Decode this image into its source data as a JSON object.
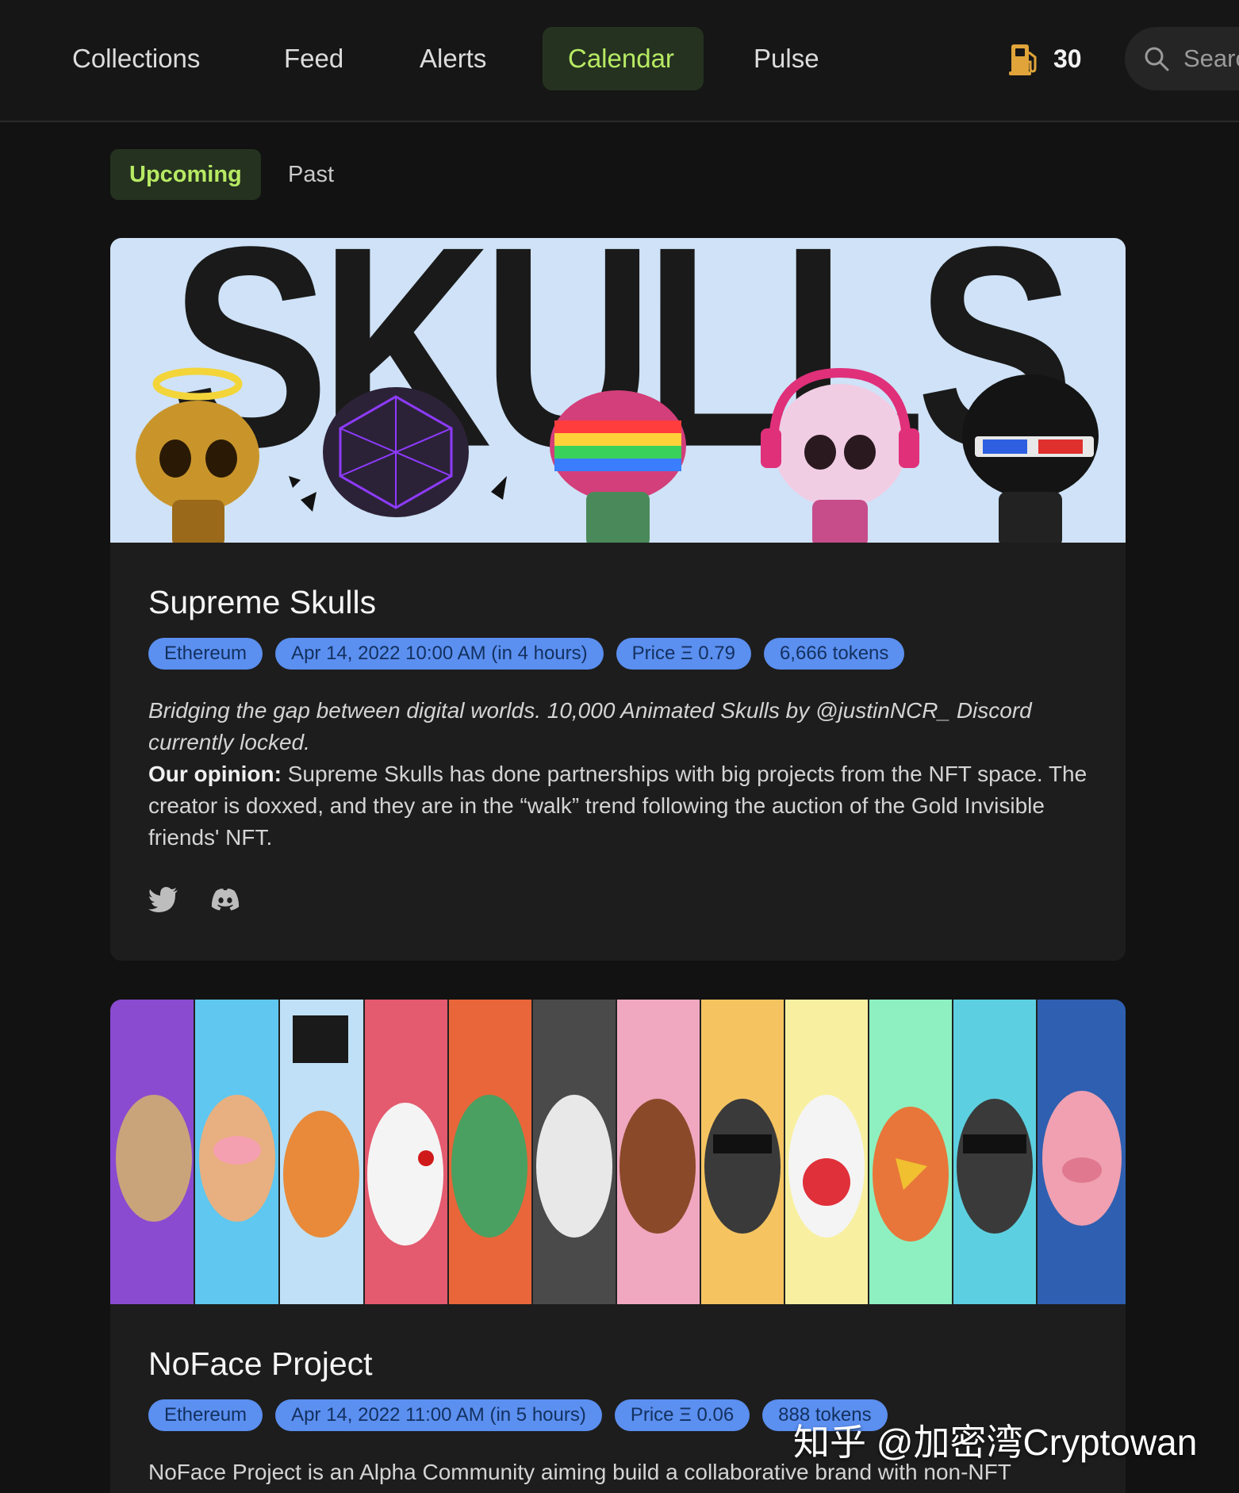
{
  "nav": {
    "items": [
      {
        "label": "Collections",
        "active": false
      },
      {
        "label": "Feed",
        "active": false
      },
      {
        "label": "Alerts",
        "active": false
      },
      {
        "label": "Calendar",
        "active": true
      },
      {
        "label": "Pulse",
        "active": false
      }
    ],
    "gas_value": "30",
    "gas_icon": "fuel-pump-icon",
    "search_placeholder": "Searc",
    "search_icon": "search-icon"
  },
  "subtabs": [
    {
      "label": "Upcoming",
      "active": true
    },
    {
      "label": "Past",
      "active": false
    }
  ],
  "colors": {
    "accent": "#b7ea63",
    "accent_bg": "#253220",
    "badge_bg": "#5b8ff0",
    "badge_text": "#13315f",
    "card_bg": "#1d1d1d",
    "page_bg": "#121212"
  },
  "cards": [
    {
      "banner_text": "SKULLS",
      "title": "Supreme Skulls",
      "badges": [
        "Ethereum",
        "Apr 14, 2022 10:00 AM (in 4 hours)",
        "Price Ξ 0.79",
        "6,666 tokens"
      ],
      "tagline": "Bridging the gap between digital worlds. 10,000 Animated Skulls by @justinNCR_ Discord currently locked.",
      "opinion_label": "Our opinion:",
      "opinion": " Supreme Skulls has done partnerships with big projects from the NFT space. The creator is doxxed, and they are in the “walk” trend following the auction of the Gold Invisible friends' NFT.",
      "social": [
        "twitter-icon",
        "discord-icon"
      ]
    },
    {
      "title": "NoFace Project",
      "badges": [
        "Ethereum",
        "Apr 14, 2022 11:00 AM (in 5 hours)",
        "Price Ξ 0.06",
        "888 tokens"
      ],
      "description": "NoFace Project is an Alpha Community aiming build a collaborative brand with non-NFT"
    }
  ],
  "watermark": "知乎 @加密湾Cryptowan"
}
